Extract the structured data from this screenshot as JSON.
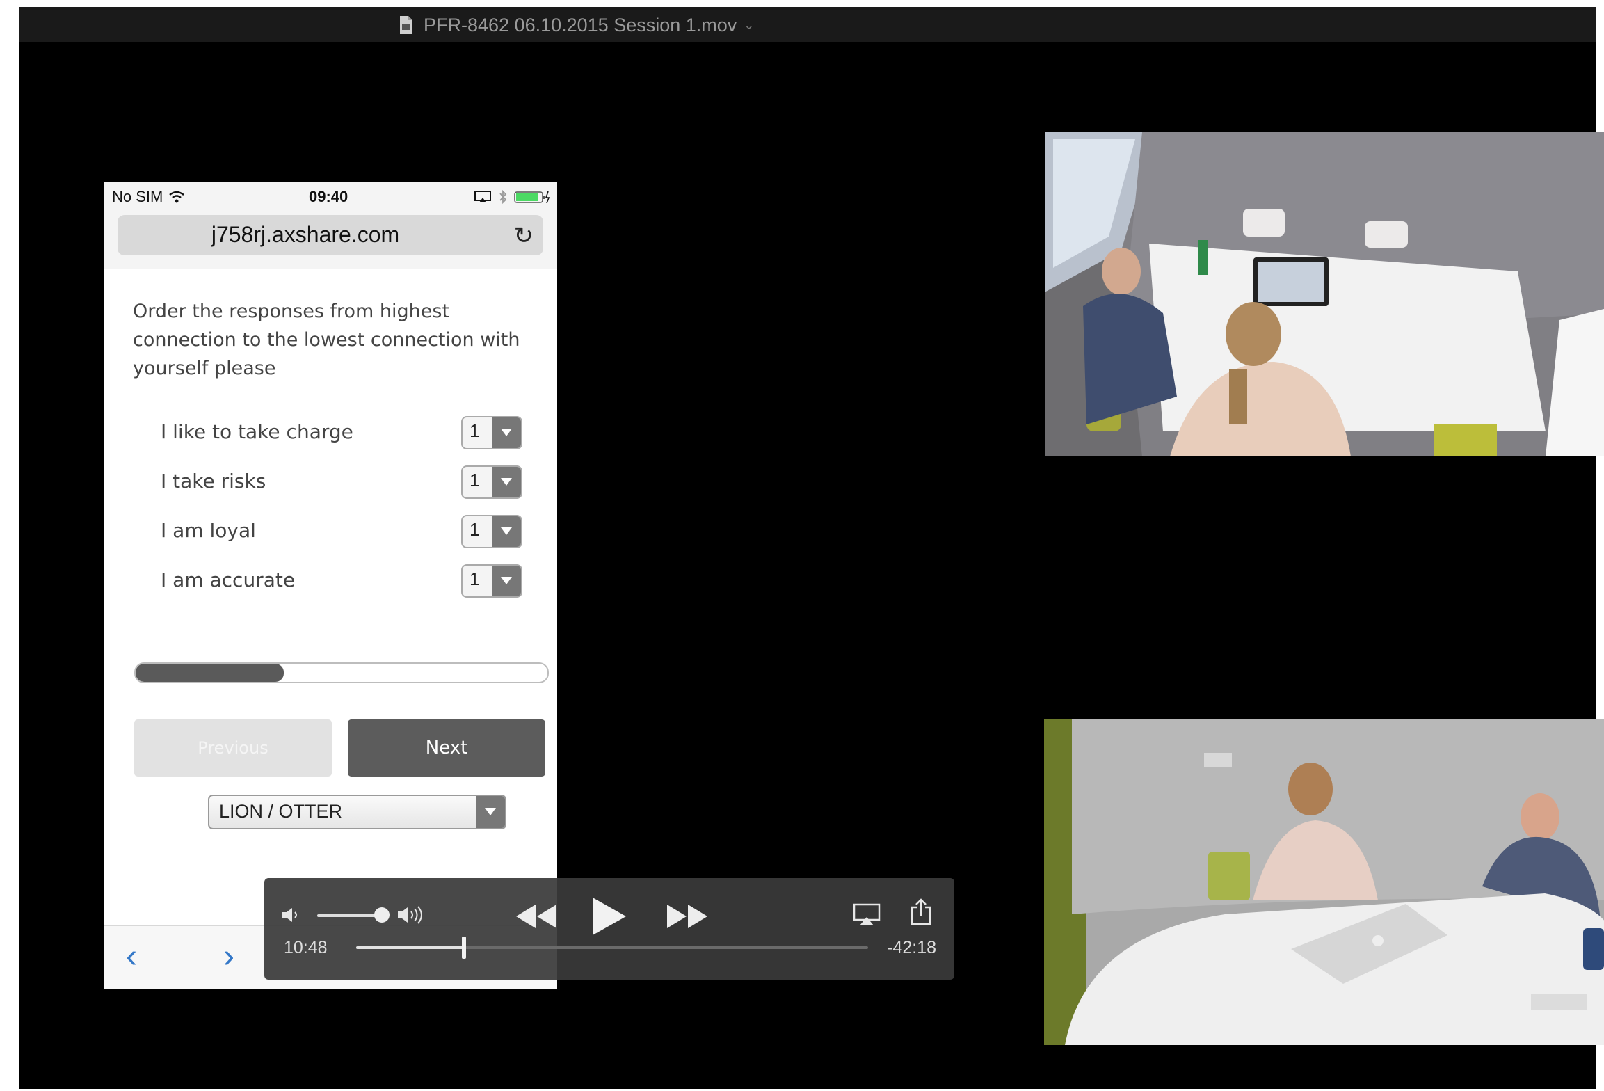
{
  "window": {
    "title": "PFR-8462 06.10.2015 Session 1.mov"
  },
  "phone": {
    "status": {
      "carrier": "No SIM",
      "time": "09:40"
    },
    "url": "j758rj.axshare.com",
    "question": "Order the responses from highest connection to the lowest connection with yourself please",
    "options": [
      {
        "label": "I like to take charge",
        "value": "1"
      },
      {
        "label": "I take risks",
        "value": "1"
      },
      {
        "label": "I am loyal",
        "value": "1"
      },
      {
        "label": "I am accurate",
        "value": "1"
      }
    ],
    "progress_fraction": 0.36,
    "prev_label": "Previous",
    "next_label": "Next",
    "dropdown_value": "LION / OTTER"
  },
  "player": {
    "elapsed": "10:48",
    "remaining": "-42:18",
    "playhead_fraction": 0.21,
    "volume_fraction": 0.95
  },
  "icons": {
    "back": "chevron-left-icon",
    "forward": "chevron-right-icon",
    "rewind": "rewind-icon",
    "play": "play-icon",
    "fast_forward": "fast-forward-icon",
    "airplay": "airplay-icon",
    "share": "share-icon"
  },
  "colors": {
    "nav_blue": "#3478c8",
    "button_dark": "#5c5c5c",
    "button_disabled": "#e2e2e2",
    "battery_green": "#4cd964"
  }
}
